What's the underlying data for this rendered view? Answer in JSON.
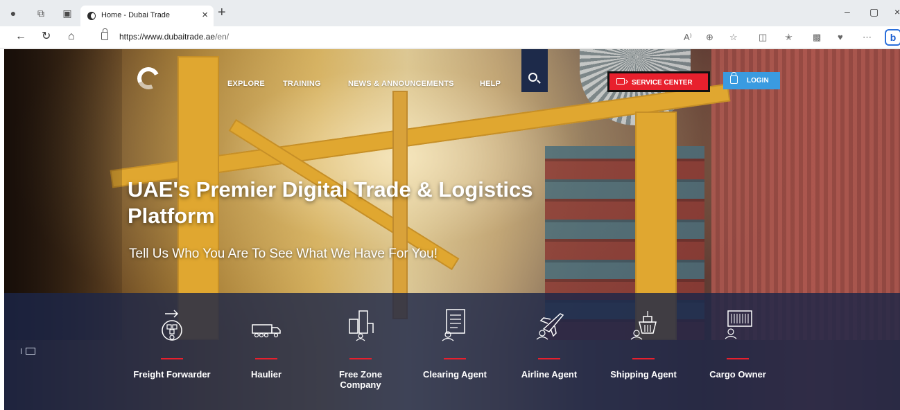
{
  "browser": {
    "tab_title": "Home - Dubai Trade",
    "tab_close": "×",
    "new_tab": "+",
    "url_main": "https://www.dubaitrade.ae",
    "url_path": "/en/",
    "bing_label": "b",
    "window_controls": [
      "–",
      "▢",
      "×"
    ],
    "icons": [
      "profile-icon",
      "workspaces-icon",
      "tab-actions-icon",
      "back-icon",
      "refresh-icon",
      "home-icon",
      "lock-icon",
      "read-aloud-icon",
      "zoom-icon",
      "favorite-icon",
      "split-screen-icon",
      "favorites-icon",
      "collections-icon",
      "extensions-icon",
      "more-icon",
      "bing-icon"
    ]
  },
  "site": {
    "nav": {
      "explore": "EXPLORE",
      "training": "TRAINING",
      "news": "NEWS & ANNOUNCEMENTS",
      "help": "HELP"
    },
    "service_center": "SERVICE CENTER",
    "login": "LOGIN",
    "hero_title": "UAE's Premier Digital Trade & Logistics Platform",
    "hero_subtitle": "Tell Us Who You Are To See What We Have For You!",
    "roles": [
      {
        "label": "Freight Forwarder",
        "icon": "freight-forwarder-icon"
      },
      {
        "label": "Haulier",
        "icon": "truck-icon"
      },
      {
        "label": "Free Zone Company",
        "icon": "buildings-icon"
      },
      {
        "label": "Clearing Agent",
        "icon": "document-icon"
      },
      {
        "label": "Airline Agent",
        "icon": "airplane-icon"
      },
      {
        "label": "Shipping Agent",
        "icon": "ship-icon"
      },
      {
        "label": "Cargo Owner",
        "icon": "container-icon"
      }
    ]
  },
  "colors": {
    "service_red": "#e8202d",
    "login_blue": "#3a9be0",
    "panel_navy": "#1c2648"
  }
}
